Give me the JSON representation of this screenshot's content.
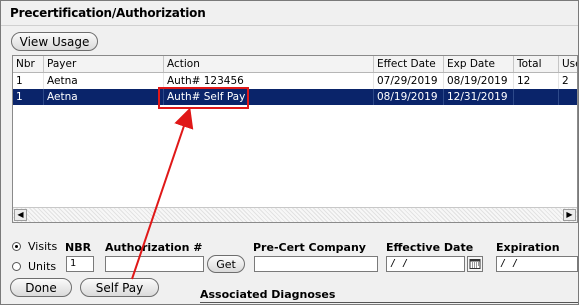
{
  "window": {
    "title": "Precertification/Authorization"
  },
  "toolbar": {
    "view_usage_label": "View Usage"
  },
  "grid": {
    "columns": [
      "Nbr",
      "Payer",
      "Action",
      "Effect Date",
      "Exp Date",
      "Total",
      "Use"
    ],
    "rows": [
      {
        "nbr": "1",
        "payer": "Aetna",
        "action": "Auth# 123456",
        "effect_date": "07/29/2019",
        "exp_date": "08/19/2019",
        "total": "12",
        "used": "2",
        "selected": false
      },
      {
        "nbr": "1",
        "payer": "Aetna",
        "action": "Auth# Self Pay",
        "effect_date": "08/19/2019",
        "exp_date": "12/31/2019",
        "total": "",
        "used": "",
        "selected": true
      }
    ]
  },
  "form": {
    "visits_label": "Visits",
    "units_label": "Units",
    "selected_radio": "Visits",
    "nbr_label": "NBR",
    "nbr_value": "1",
    "authorization_label": "Authorization #",
    "authorization_value": "",
    "get_label": "Get",
    "precert_company_label": "Pre-Cert Company",
    "precert_company_value": "",
    "effective_date_label": "Effective Date",
    "effective_date_value": " / /",
    "expiration_date_label": "Expiration Date",
    "expiration_date_value": " / /"
  },
  "footer": {
    "done_label": "Done",
    "self_pay_label": "Self Pay",
    "associated_diagnoses_label": "Associated Diagnoses"
  },
  "annotation": {
    "highlight_color": "#e01818"
  },
  "colors": {
    "selected_row": "#0a246a"
  }
}
